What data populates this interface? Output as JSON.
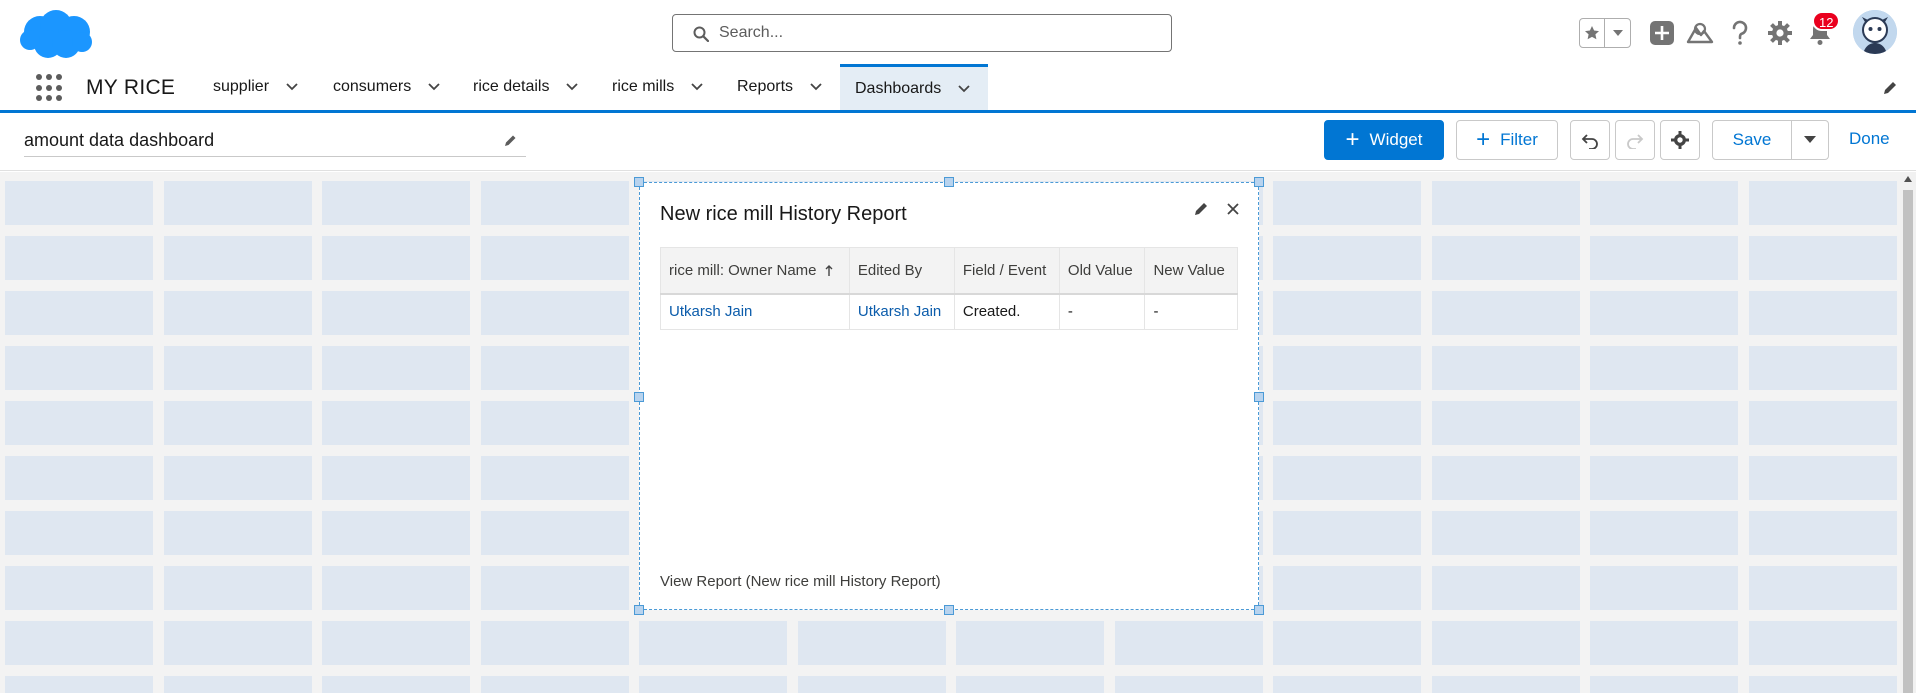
{
  "header": {
    "search_placeholder": "Search...",
    "notification_count": "12",
    "colors": {
      "brand": "#0176d3",
      "logo": "#1b96ff",
      "badge": "#ea001e"
    }
  },
  "nav": {
    "app_name": "MY RICE",
    "items": [
      {
        "label": "supplier",
        "active": false
      },
      {
        "label": "consumers",
        "active": false
      },
      {
        "label": "rice details",
        "active": false
      },
      {
        "label": "rice mills",
        "active": false
      },
      {
        "label": "Reports",
        "active": false
      },
      {
        "label": "Dashboards",
        "active": true
      }
    ]
  },
  "toolbar": {
    "dashboard_name": "amount data dashboard",
    "widget_label": "Widget",
    "filter_label": "Filter",
    "save_label": "Save",
    "done_label": "Done"
  },
  "widget": {
    "title": "New rice mill History Report",
    "columns": [
      "rice mill: Owner Name",
      "Edited By",
      "Field / Event",
      "Old Value",
      "New Value"
    ],
    "rows": [
      {
        "owner": "Utkarsh Jain",
        "edited_by": "Utkarsh Jain",
        "field": "Created.",
        "old": "-",
        "new": "-"
      }
    ],
    "footer": "View Report (New rice mill History Report)"
  }
}
